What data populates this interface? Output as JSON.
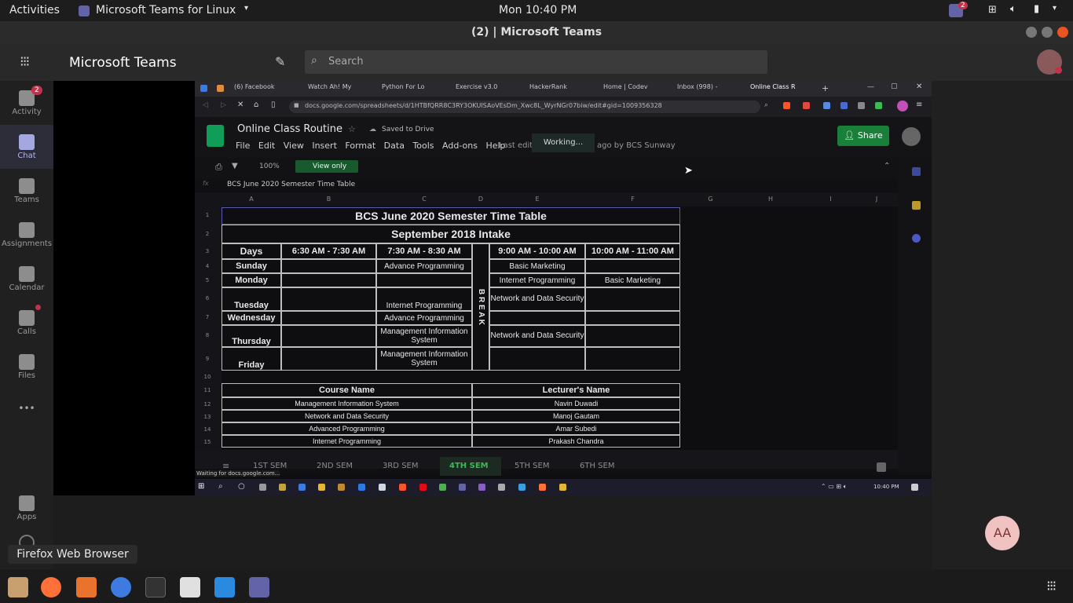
{
  "system": {
    "activities": "Activities",
    "app_menu": "Microsoft Teams for Linux",
    "clock": "Mon 10:40 PM",
    "teams_badge": "2"
  },
  "window": {
    "title": "(2) | Microsoft Teams"
  },
  "teams": {
    "title": "Microsoft Teams",
    "search_placeholder": "Search",
    "rail": [
      {
        "label": "Activity",
        "badge": "2"
      },
      {
        "label": "Chat"
      },
      {
        "label": "Teams"
      },
      {
        "label": "Assignments"
      },
      {
        "label": "Calendar"
      },
      {
        "label": "Calls"
      },
      {
        "label": "Files"
      },
      {
        "label": "Apps"
      }
    ],
    "more": "•••",
    "tooltip": "Firefox Web Browser",
    "avatar_initials": "AA"
  },
  "browser": {
    "tabs": [
      "(6) Facebook",
      "Watch Ah! My",
      "Python For Lo",
      "Exercise v3.0",
      "HackerRank",
      "Home | Codev",
      "Inbox (998) - ",
      "Online Class R"
    ],
    "url": "docs.google.com/spreadsheets/d/1HTBfQRR8C3RY3OKUISAoVEsDm_Xwc8L_WyrNGr07biw/edit#gid=1009356328",
    "status": "Waiting for docs.google.com...",
    "taskbar_time": "10:40 PM"
  },
  "sheets": {
    "doc_title": "Online Class Routine",
    "saved": "Saved to Drive",
    "menus": [
      "File",
      "Edit",
      "View",
      "Insert",
      "Format",
      "Data",
      "Tools",
      "Add-ons",
      "Help"
    ],
    "last_edit_left": "Last edit",
    "last_edit_right": "ago by BCS Sunway",
    "working": "Working...",
    "share": "Share",
    "zoom": "100%",
    "view_only": "View only",
    "formula": "BCS June 2020 Semester Time Table",
    "columns": [
      "A",
      "B",
      "C",
      "D",
      "E",
      "F",
      "G",
      "H",
      "I",
      "J"
    ],
    "rows": [
      "1",
      "2",
      "3",
      "4",
      "5",
      "6",
      "7",
      "8",
      "9",
      "10",
      "11",
      "12",
      "13",
      "14",
      "15"
    ],
    "title": "BCS June 2020 Semester Time Table",
    "subtitle": "September 2018 Intake",
    "headers": [
      "Days",
      "6:30 AM - 7:30 AM",
      "7:30 AM - 8:30 AM",
      "9:00 AM - 10:00 AM",
      "10:00 AM - 11:00 AM"
    ],
    "break_label": "B R E A K",
    "days": [
      "Sunday",
      "Monday",
      "Tuesday",
      "Wednesday",
      "Thursday",
      "Friday"
    ],
    "c_col": [
      "Advance Programming",
      "",
      "Internet Programming",
      "Advance Programming",
      "Management Information System",
      "Management Information System"
    ],
    "e_col": [
      "Basic Marketing",
      "Internet Programming",
      "Network and Data Security",
      "",
      "Network and Data Security",
      ""
    ],
    "f_col": [
      "",
      "Basic Marketing",
      "",
      "",
      "",
      ""
    ],
    "course_header": "Course Name",
    "lecturer_header": "Lecturer's Name",
    "courses": [
      {
        "course": "Management Information System",
        "lecturer": "Navin Duwadi"
      },
      {
        "course": "Network and Data Security",
        "lecturer": "Manoj Gautam"
      },
      {
        "course": "Advanced Programming",
        "lecturer": "Amar Subedi"
      },
      {
        "course": "Internet Programming",
        "lecturer": "Prakash Chandra"
      }
    ],
    "sheet_tabs": [
      "1ST SEM",
      "2ND SEM",
      "3RD SEM",
      "4TH SEM",
      "5TH SEM",
      "6TH SEM"
    ],
    "active_tab": "4TH SEM"
  },
  "colors": {
    "teams_purple": "#6264a7",
    "sheets_green": "#188038",
    "active_tab": "#3cba54"
  }
}
